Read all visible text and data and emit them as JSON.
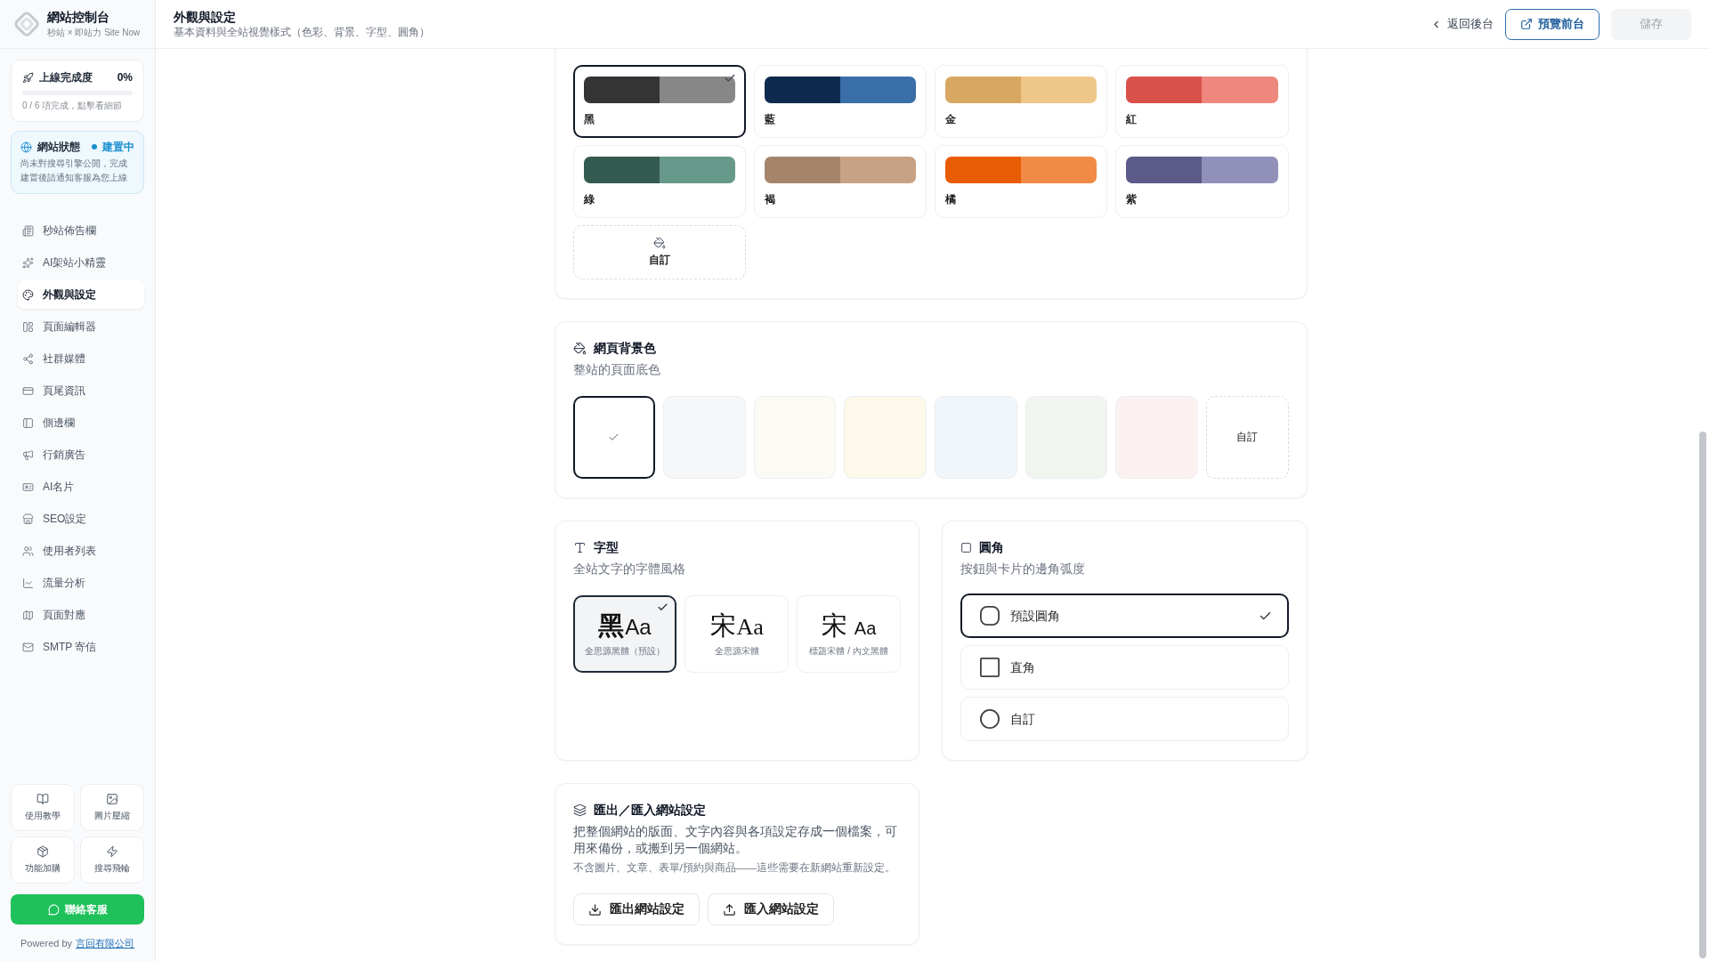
{
  "sidebar": {
    "brand": {
      "title": "網站控制台",
      "subtitle": "秒站 × 即站力 Site Now"
    },
    "progress": {
      "title": "上線完成度",
      "percent": "0%",
      "detail": "0 / 6 項完成，點擊看細節"
    },
    "status": {
      "title": "網站狀態",
      "badge": "建置中",
      "message": "尚未對搜尋引擎公開，完成建置後請通知客服為您上線"
    },
    "nav": [
      {
        "label": "秒站佈告欄",
        "selected": false
      },
      {
        "label": "AI架站小精靈",
        "selected": false
      },
      {
        "label": "外觀與設定",
        "selected": true
      },
      {
        "label": "頁面編輯器",
        "selected": false
      },
      {
        "label": "社群媒體",
        "selected": false
      },
      {
        "label": "頁尾資訊",
        "selected": false
      },
      {
        "label": "側邊欄",
        "selected": false
      },
      {
        "label": "行銷廣告",
        "selected": false
      },
      {
        "label": "AI名片",
        "selected": false
      },
      {
        "label": "SEO設定",
        "selected": false
      },
      {
        "label": "使用者列表",
        "selected": false
      },
      {
        "label": "流量分析",
        "selected": false
      },
      {
        "label": "頁面對應",
        "selected": false
      },
      {
        "label": "SMTP 寄信",
        "selected": false
      }
    ],
    "tools": [
      {
        "label": "使用教學"
      },
      {
        "label": "圖片壓縮"
      },
      {
        "label": "功能加購"
      },
      {
        "label": "搜尋飛輪"
      }
    ],
    "contact_button": "聯絡客服",
    "footer": {
      "prefix": "Powered by",
      "link": "言回有限公司"
    }
  },
  "header": {
    "title": "外觀與設定",
    "subtitle": "基本資料與全站視覺樣式（色彩、背景、字型、圓角）",
    "back_link": "返回後台",
    "preview_button": "預覽前台",
    "save_button": {
      "label": "儲存",
      "disabled": true
    }
  },
  "theme_colors": {
    "options": [
      {
        "kind": "palette",
        "label": "黑",
        "swatches": [
          {
            "color": "#343434"
          },
          {
            "color": "#878787"
          }
        ],
        "selected": true
      },
      {
        "kind": "palette",
        "label": "藍",
        "swatches": [
          {
            "color": "#0f2a4f"
          },
          {
            "color": "#3a6ea8"
          }
        ],
        "selected": false
      },
      {
        "kind": "palette",
        "label": "金",
        "swatches": [
          {
            "color": "#d8a862"
          },
          {
            "color": "#eec68a"
          }
        ],
        "selected": false
      },
      {
        "kind": "palette",
        "label": "紅",
        "swatches": [
          {
            "color": "#d9524a"
          },
          {
            "color": "#ee877d"
          }
        ],
        "selected": false
      },
      {
        "kind": "palette",
        "label": "綠",
        "swatches": [
          {
            "color": "#355b51"
          },
          {
            "color": "#67998b"
          }
        ],
        "selected": false
      },
      {
        "kind": "palette",
        "label": "褐",
        "swatches": [
          {
            "color": "#a5846b"
          },
          {
            "color": "#c8a284"
          }
        ],
        "selected": false
      },
      {
        "kind": "palette",
        "label": "橘",
        "swatches": [
          {
            "color": "#e85d04"
          },
          {
            "color": "#f18a45"
          }
        ],
        "selected": false
      },
      {
        "kind": "palette",
        "label": "紫",
        "swatches": [
          {
            "color": "#5b5a88"
          },
          {
            "color": "#9190b8"
          }
        ],
        "selected": false
      },
      {
        "kind": "custom",
        "label": "自訂",
        "selected": false
      }
    ]
  },
  "background": {
    "title": "網頁背景色",
    "subtitle": "整站的頁面底色",
    "options": [
      {
        "kind": "color",
        "color": "#ffffff",
        "selected": true
      },
      {
        "kind": "color",
        "color": "#f5f7f9",
        "selected": false
      },
      {
        "kind": "color",
        "color": "#fbfaf3",
        "selected": false
      },
      {
        "kind": "color",
        "color": "#fcf9ea",
        "selected": false
      },
      {
        "kind": "color",
        "color": "#f1f6fa",
        "selected": false
      },
      {
        "kind": "color",
        "color": "#f0f5ef",
        "selected": false
      },
      {
        "kind": "color",
        "color": "#fcf1f1",
        "selected": false
      },
      {
        "kind": "custom",
        "label": "自訂",
        "selected": false
      }
    ]
  },
  "font": {
    "title": "字型",
    "subtitle": "全站文字的字體風格",
    "options": [
      {
        "kind": "sans",
        "glyph": "黑",
        "latin": "Aa",
        "label": "全思源黑體（預設）",
        "selected": true
      },
      {
        "kind": "serif",
        "glyph": "宋",
        "latin": "Aa",
        "label": "全思源宋體",
        "selected": false
      },
      {
        "kind": "mixed",
        "glyph": "宋",
        "latin": "Aa",
        "label": "標題宋體 / 內文黑體",
        "selected": false
      }
    ]
  },
  "corner_radius": {
    "title": "圓角",
    "subtitle": "按鈕與卡片的邊角弧度",
    "options": [
      {
        "kind": "rounded",
        "label": "預設圓角",
        "selected": true
      },
      {
        "kind": "square",
        "label": "直角",
        "selected": false
      },
      {
        "kind": "custom",
        "label": "自訂",
        "selected": false
      }
    ]
  },
  "export": {
    "title": "匯出／匯入網站設定",
    "description": "把整個網站的版面、文字內容與各項設定存成一個檔案，可用來備份，或搬到另一個網站。",
    "note": "不含圖片、文章、表單/預約與商品——這些需要在新網站重新設定。",
    "buttons": [
      {
        "kind": "export",
        "label": "匯出網站設定"
      },
      {
        "kind": "import",
        "label": "匯入網站設定"
      }
    ]
  }
}
